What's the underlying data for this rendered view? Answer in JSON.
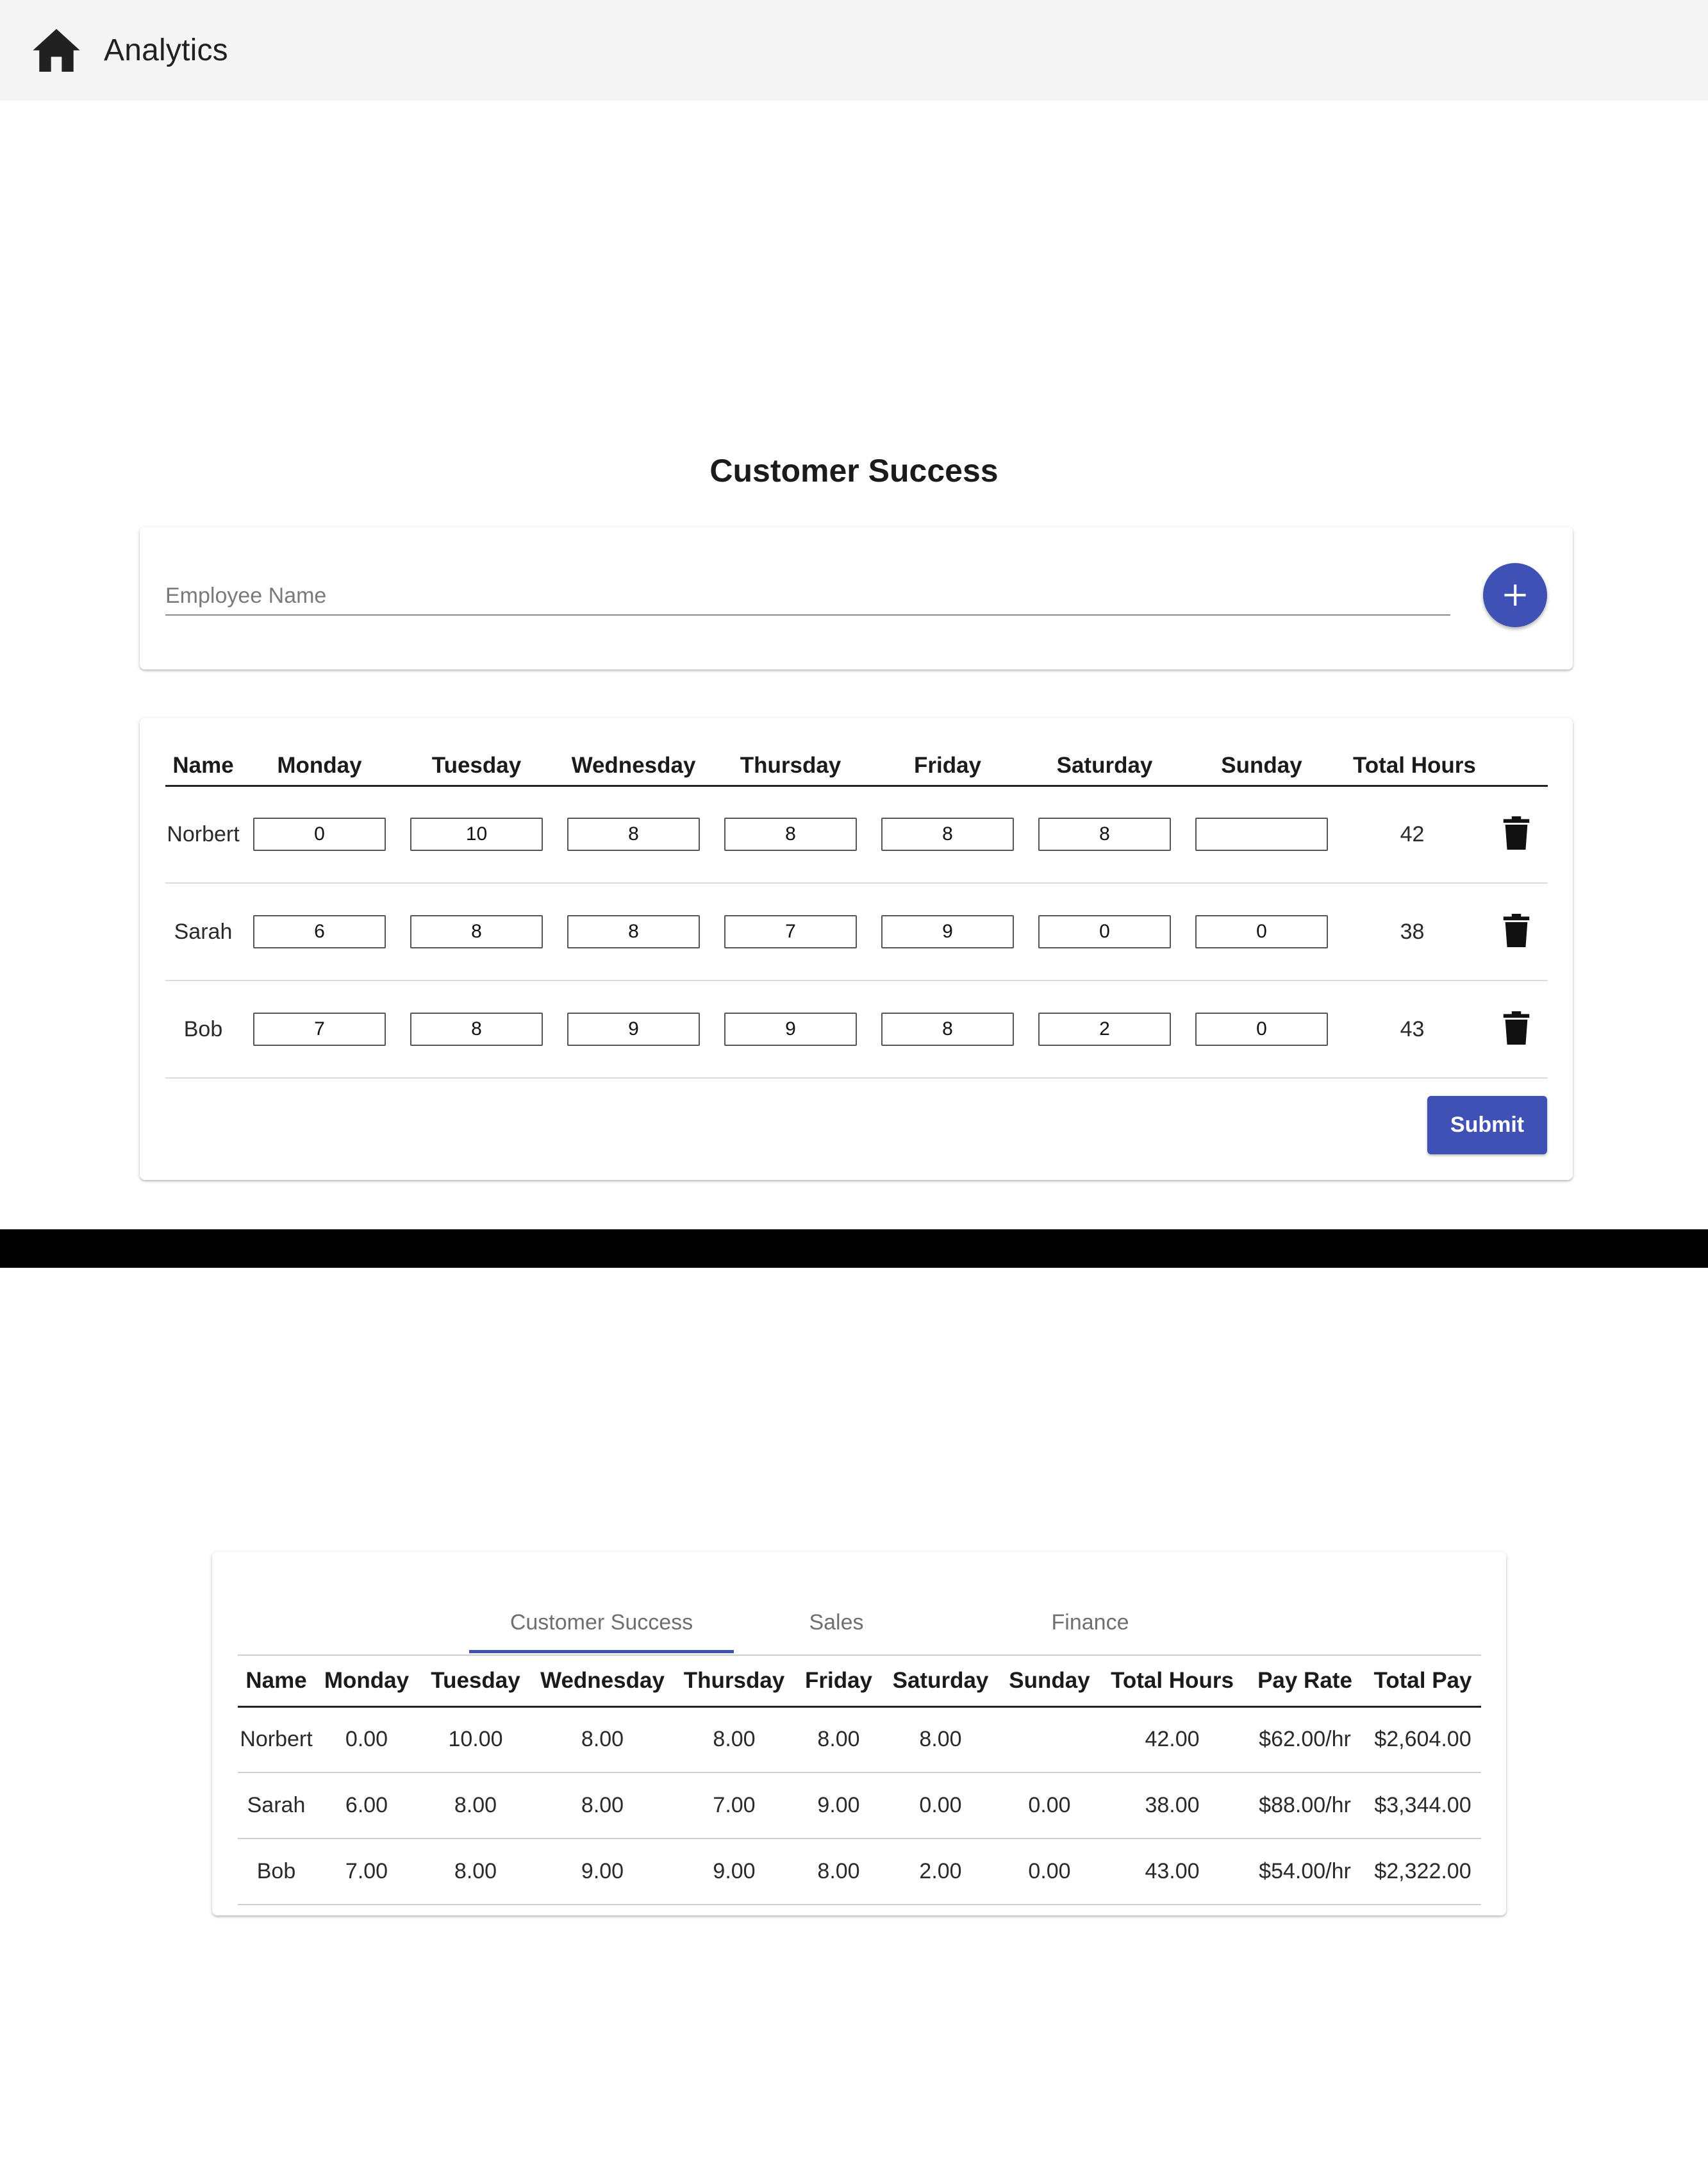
{
  "app_bar": {
    "title": "Analytics",
    "home_icon": "home-icon"
  },
  "department_title": "Customer Success",
  "add_employee": {
    "placeholder": "Employee Name",
    "add_icon": "plus-icon"
  },
  "edit_table": {
    "headers": [
      "Name",
      "Monday",
      "Tuesday",
      "Wednesday",
      "Thursday",
      "Friday",
      "Saturday",
      "Sunday",
      "Total Hours",
      ""
    ],
    "rows": [
      {
        "name": "Norbert",
        "hours": [
          "0",
          "10",
          "8",
          "8",
          "8",
          "8",
          ""
        ],
        "total": "42"
      },
      {
        "name": "Sarah",
        "hours": [
          "6",
          "8",
          "8",
          "7",
          "9",
          "0",
          "0"
        ],
        "total": "38"
      },
      {
        "name": "Bob",
        "hours": [
          "7",
          "8",
          "9",
          "9",
          "8",
          "2",
          "0"
        ],
        "total": "43"
      }
    ],
    "delete_icon": "trash-icon",
    "submit_label": "Submit"
  },
  "summary": {
    "tabs": [
      "Customer Success",
      "Sales",
      "Finance"
    ],
    "active_tab": "Customer Success",
    "headers": [
      "Name",
      "Monday",
      "Tuesday",
      "Wednesday",
      "Thursday",
      "Friday",
      "Saturday",
      "Sunday",
      "Total Hours",
      "Pay Rate",
      "Total Pay"
    ],
    "rows": [
      [
        "Norbert",
        "0.00",
        "10.00",
        "8.00",
        "8.00",
        "8.00",
        "8.00",
        "",
        "42.00",
        "$62.00/hr",
        "$2,604.00"
      ],
      [
        "Sarah",
        "6.00",
        "8.00",
        "8.00",
        "7.00",
        "9.00",
        "0.00",
        "0.00",
        "38.00",
        "$88.00/hr",
        "$3,344.00"
      ],
      [
        "Bob",
        "7.00",
        "8.00",
        "9.00",
        "9.00",
        "8.00",
        "2.00",
        "0.00",
        "43.00",
        "$54.00/hr",
        "$2,322.00"
      ]
    ]
  },
  "colors": {
    "primary": "#3f51b5",
    "app_bar_bg": "#f5f5f5",
    "divider": "#000000"
  }
}
